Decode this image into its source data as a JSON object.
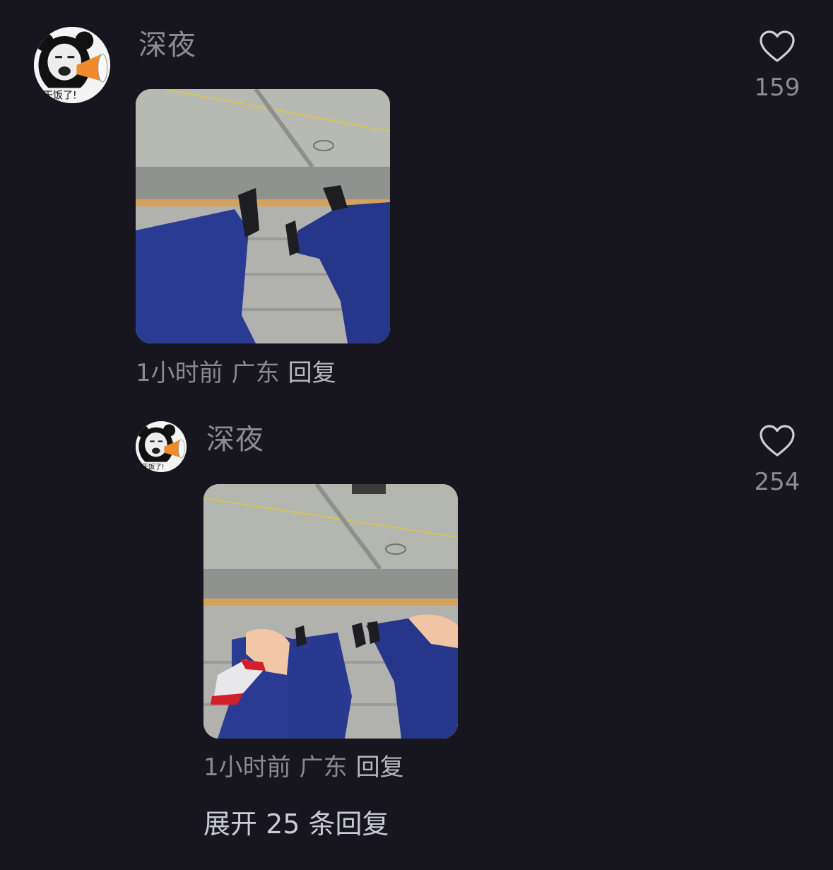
{
  "comments": [
    {
      "username": "深夜",
      "time": "1小时前",
      "location": "广东",
      "reply_label": "回复",
      "like_count": "159",
      "avatar_icon": "meme-face-megaphone-avatar",
      "avatar_text": "干饭了!",
      "photo_subject": "legs-in-blue-uniform-on-steps"
    },
    {
      "username": "深夜",
      "time": "1小时前",
      "location": "广东",
      "reply_label": "回复",
      "like_count": "254",
      "avatar_icon": "meme-face-megaphone-avatar",
      "avatar_text": "干饭了!",
      "photo_subject": "legs-in-blue-uniform-bandaged-wrist"
    }
  ],
  "expand_replies": "展开 25 条回复",
  "colors": {
    "background": "#17161e",
    "username": "#8d8c93",
    "meta": "#8a8990",
    "expand": "#c9cbd6",
    "uniform_blue": "#2a3b94"
  }
}
